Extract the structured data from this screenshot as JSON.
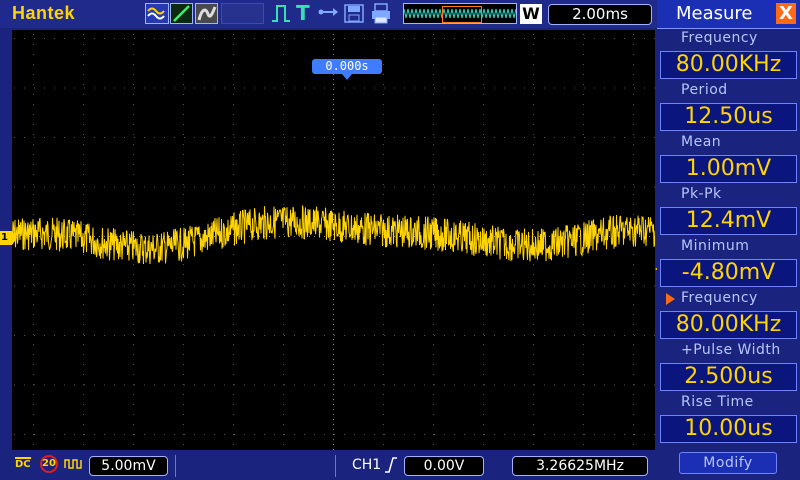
{
  "app": {
    "brand": "Hantek"
  },
  "toolbar": {
    "timebase": "2.00ms",
    "zoom_badge": "W",
    "icons": [
      "acquire-mode-icon",
      "ramp-icon",
      "persistence-icon",
      "trigger-mode-pulse-icon",
      "trigger-t-icon",
      "usb-icon",
      "save-icon",
      "print-icon",
      "waveform-overview-icon"
    ],
    "trigger_letter": "T"
  },
  "screen": {
    "trigger_position": "0.000s",
    "ch1_marker": "1",
    "waveform_color": "#ffd400"
  },
  "bottom": {
    "coupling": "DC",
    "bandwidth_limit": "20",
    "volt_div": "5.00mV",
    "trigger_source": "CH1",
    "trigger_level": "0.00V",
    "frequency_counter": "3.26625MHz"
  },
  "measure": {
    "title": "Measure",
    "close": "X",
    "items": [
      {
        "label": "Frequency",
        "value": "80.00KHz"
      },
      {
        "label": "Period",
        "value": "12.50us"
      },
      {
        "label": "Mean",
        "value": "1.00mV"
      },
      {
        "label": "Pk-Pk",
        "value": "12.4mV"
      },
      {
        "label": "Minimum",
        "value": "-4.80mV"
      },
      {
        "label": "Frequency",
        "value": "80.00KHz",
        "selected": true
      },
      {
        "label": "+Pulse Width",
        "value": "2.500us"
      },
      {
        "label": "Rise Time",
        "value": "10.00us"
      }
    ],
    "modify_label": "Modify"
  },
  "colors": {
    "accent": "#ff6a16",
    "trace": "#ffd400",
    "panel": "#1a237e"
  }
}
